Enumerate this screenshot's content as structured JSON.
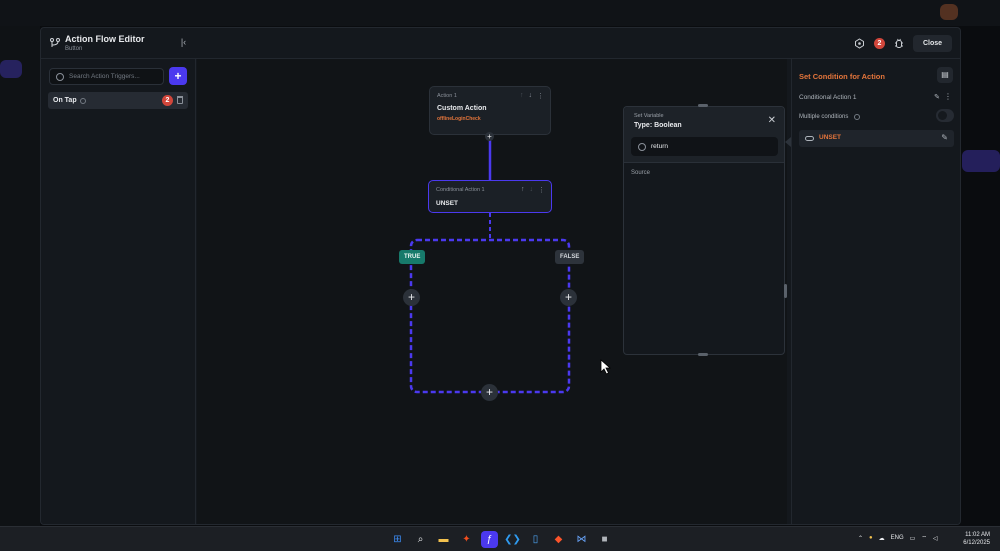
{
  "dialog": {
    "title": "Action Flow Editor",
    "subtitle": "Button",
    "header_badge": "2",
    "close_label": "Close"
  },
  "left_panel": {
    "search_placeholder": "Search Action Triggers...",
    "add_label": "+",
    "trigger": {
      "label": "On Tap",
      "badge": "2"
    }
  },
  "canvas": {
    "action_node": {
      "caption": "Action 1",
      "title": "Custom Action",
      "subtitle": "offlineLoginCheck"
    },
    "conditional_node": {
      "caption": "Conditional Action 1",
      "title": "UNSET"
    },
    "true_label": "TRUE",
    "false_label": "FALSE",
    "branch_color": "#4b39ef"
  },
  "popover": {
    "caption": "Set Variable",
    "title": "Type: Boolean",
    "search_value": "return",
    "section_label": "Source"
  },
  "right_panel": {
    "title": "Set Condition for Action",
    "conditional_name": "Conditional Action 1",
    "multiple_conditions_label": "Multiple conditions",
    "multiple_conditions_enabled": false,
    "condition_value": "UNSET"
  },
  "taskbar": {
    "tray_lang": "ENG",
    "time": "11:02 AM",
    "date": "6/12/2025"
  },
  "colors": {
    "accent": "#4b39ef",
    "orange": "#e4753b",
    "true_tag": "#177a6b",
    "badge": "#d1463b"
  }
}
